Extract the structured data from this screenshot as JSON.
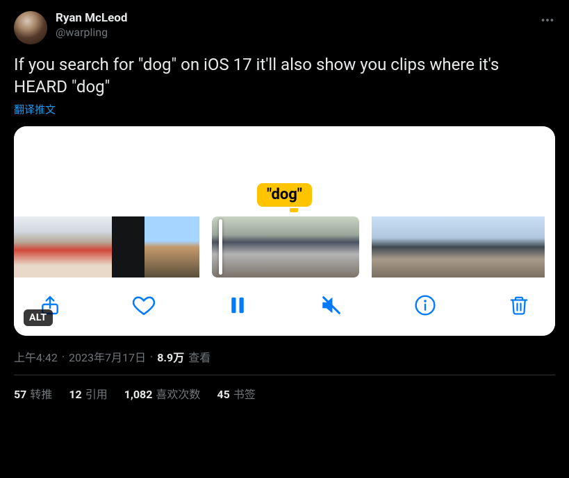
{
  "author": {
    "display_name": "Ryan McLeod",
    "handle": "@warpling"
  },
  "tweet_text": "If you search for \"dog\" on iOS 17 it'll also show you clips where it's HEARD \"dog\"",
  "translate_label": "翻译推文",
  "media": {
    "bubble_text": "\"dog\"",
    "alt_badge": "ALT"
  },
  "timestamp": {
    "time": "上午4:42",
    "sep1": " · ",
    "date": "2023年7月17日",
    "sep2": " · ",
    "views_count": "8.9万",
    "views_label": " 查看"
  },
  "stats": {
    "retweets_count": "57",
    "retweets_label": "转推",
    "quotes_count": "12",
    "quotes_label": "引用",
    "likes_count": "1,082",
    "likes_label": "喜欢次数",
    "bookmarks_count": "45",
    "bookmarks_label": "书签"
  }
}
